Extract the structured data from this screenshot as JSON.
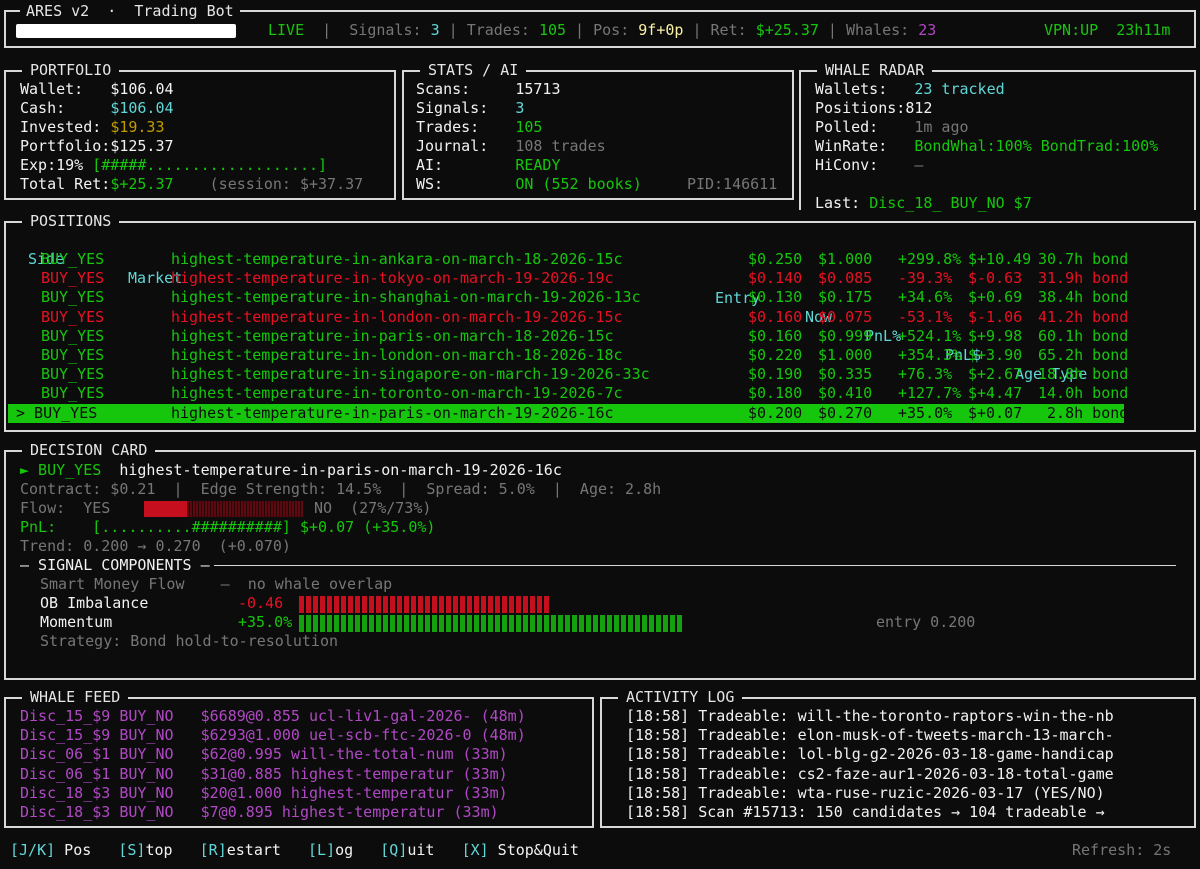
{
  "header": {
    "title": "ARES v2  ·  Trading Bot",
    "live": "LIVE",
    "signals_label": "Signals:",
    "signals": "3",
    "trades_label": "Trades:",
    "trades": "105",
    "pos_label": "Pos:",
    "pos": "9f+0p",
    "ret_label": "Ret:",
    "ret": "$+25.37",
    "whales_label": "Whales:",
    "whales": "23",
    "vpn": "VPN:UP",
    "uptime": "23h11m"
  },
  "portfolio": {
    "title": "PORTFOLIO",
    "wallet_label": "Wallet:",
    "wallet": "$106.04",
    "cash_label": "Cash:",
    "cash": "$106.04",
    "invested_label": "Invested:",
    "invested": "$19.33",
    "portfolio_label": "Portfolio:",
    "portfolio": "$125.37",
    "exp_label": "Exp:19%",
    "exp_bar": "[#####...................]",
    "exp_fraction": 0.19,
    "totalret_label": "Total Ret:",
    "totalret": "$+25.37",
    "session": "(session: $+37.37"
  },
  "stats": {
    "title": "STATS / AI",
    "scans_label": "Scans:",
    "scans": "15713",
    "signals_label": "Signals:",
    "signals": "3",
    "trades_label": "Trades:",
    "trades": "105",
    "journal_label": "Journal:",
    "journal": "108 trades",
    "ai_label": "AI:",
    "ai": "READY",
    "ws_label": "WS:",
    "ws": "ON (552 books)",
    "pid": "PID:146611"
  },
  "whale_radar": {
    "title": "WHALE RADAR",
    "wallets_label": "Wallets:",
    "wallets": "23 tracked",
    "positions_label": "Positions:",
    "positions": "812",
    "polled_label": "Polled:",
    "polled": "1m ago",
    "winrate_label": "WinRate:",
    "winrate": "BondWhal:100% BondTrad:100%",
    "hiconv_label": "HiConv:",
    "hiconv": "—",
    "last_label": "Last:",
    "last": "Disc_18_ BUY_NO $7"
  },
  "positions": {
    "title": "POSITIONS",
    "headers": {
      "side": "Side",
      "market": "Market",
      "entry": "Entry",
      "now": "Now",
      "pnlpct": "PnL%",
      "pnlusd": "PnL$",
      "age": "Age Type"
    },
    "rows": [
      {
        "side": "BUY_YES",
        "market": "highest-temperature-in-ankara-on-march-18-2026-15c",
        "entry": "$0.250",
        "now": "$1.000",
        "pnlpct": "+299.8%",
        "pnlusd": "$+10.49",
        "age": "30.7h bond",
        "tone": "green"
      },
      {
        "side": "BUY_YES",
        "market": "highest-temperature-in-tokyo-on-march-19-2026-19c",
        "entry": "$0.140",
        "now": "$0.085",
        "pnlpct": "-39.3%",
        "pnlusd": "$-0.63",
        "age": "31.9h bond",
        "tone": "red"
      },
      {
        "side": "BUY_YES",
        "market": "highest-temperature-in-shanghai-on-march-19-2026-13c",
        "entry": "$0.130",
        "now": "$0.175",
        "pnlpct": "+34.6%",
        "pnlusd": "$+0.69",
        "age": "38.4h bond",
        "tone": "green"
      },
      {
        "side": "BUY_YES",
        "market": "highest-temperature-in-london-on-march-19-2026-15c",
        "entry": "$0.160",
        "now": "$0.075",
        "pnlpct": "-53.1%",
        "pnlusd": "$-1.06",
        "age": "41.2h bond",
        "tone": "red"
      },
      {
        "side": "BUY_YES",
        "market": "highest-temperature-in-paris-on-march-18-2026-15c",
        "entry": "$0.160",
        "now": "$0.999",
        "pnlpct": "+524.1%",
        "pnlusd": "$+9.98",
        "age": "60.1h bond",
        "tone": "green"
      },
      {
        "side": "BUY_YES",
        "market": "highest-temperature-in-london-on-march-18-2026-18c",
        "entry": "$0.220",
        "now": "$1.000",
        "pnlpct": "+354.3%",
        "pnlusd": "$+3.90",
        "age": "65.2h bond",
        "tone": "green"
      },
      {
        "side": "BUY_YES",
        "market": "highest-temperature-in-singapore-on-march-19-2026-33c",
        "entry": "$0.190",
        "now": "$0.335",
        "pnlpct": "+76.3%",
        "pnlusd": "$+2.67",
        "age": "18.8h bond",
        "tone": "green"
      },
      {
        "side": "BUY_YES",
        "market": "highest-temperature-in-toronto-on-march-19-2026-7c",
        "entry": "$0.180",
        "now": "$0.410",
        "pnlpct": "+127.7%",
        "pnlusd": "$+4.47",
        "age": "14.0h bond",
        "tone": "green"
      },
      {
        "side": "> BUY_YES",
        "market": "highest-temperature-in-paris-on-march-19-2026-16c",
        "entry": "$0.200",
        "now": "$0.270",
        "pnlpct": "+35.0%",
        "pnlusd": "$+0.07",
        "age": " 2.8h bond",
        "tone": "selected"
      }
    ]
  },
  "decision": {
    "title": "DECISION CARD",
    "side": "► BUY_YES",
    "market": "highest-temperature-in-paris-on-march-19-2026-16c",
    "meta": "Contract: $0.21  |  Edge Strength: 14.5%  |  Spread: 5.0%  |  Age: 2.8h",
    "flow_label": "Flow:",
    "flow_yes": "YES",
    "flow_no": "NO",
    "flow_pct": "(27%/73%)",
    "flow_yes_fraction": 0.27,
    "pnl_label": "PnL:",
    "pnl_bar": "[..........##########]",
    "pnl_value": "$+0.07 (+35.0%)",
    "trend": "Trend: 0.200 → 0.270  (+0.070)",
    "components_title": "— SIGNAL COMPONENTS —",
    "smart_money_label": "Smart Money Flow",
    "smart_money_value": "—  no whale overlap",
    "ob_label": "OB Imbalance",
    "ob_value": "-0.46",
    "ob_ticks": 36,
    "momentum_label": "Momentum",
    "momentum_value": "+35.0%",
    "momentum_ticks": 55,
    "momentum_note": "entry 0.200",
    "strategy": "Strategy: Bond hold-to-resolution"
  },
  "whale_feed": {
    "title": "WHALE FEED",
    "rows": [
      "Disc_15_$9 BUY_NO   $6689@0.855 ucl-liv1-gal-2026- (48m)",
      "Disc_15_$9 BUY_NO   $6293@1.000 uel-scb-ftc-2026-0 (48m)",
      "Disc_06_$1 BUY_NO   $62@0.995 will-the-total-num (33m)",
      "Disc_06_$1 BUY_NO   $31@0.885 highest-temperatur (33m)",
      "Disc_18_$3 BUY_NO   $20@1.000 highest-temperatur (33m)",
      "Disc_18_$3 BUY_NO   $7@0.895 highest-temperatur (33m)"
    ]
  },
  "activity": {
    "title": "ACTIVITY LOG",
    "rows": [
      "[18:58] Tradeable: will-the-toronto-raptors-win-the-nb",
      "[18:58] Tradeable: elon-musk-of-tweets-march-13-march-",
      "[18:58] Tradeable: lol-blg-g2-2026-03-18-game-handicap",
      "[18:58] Tradeable: cs2-faze-aur1-2026-03-18-total-game",
      "[18:58] Tradeable: wta-ruse-ruzic-2026-03-17 (YES/NO)",
      "[18:58] Scan #15713: 150 candidates → 104 tradeable →"
    ]
  },
  "footer": {
    "keys": [
      {
        "key": "[J/K]",
        "label": "Pos"
      },
      {
        "key": "[S]",
        "label": "top"
      },
      {
        "key": "[R]",
        "label": "estart"
      },
      {
        "key": "[L]",
        "label": "og"
      },
      {
        "key": "[Q]",
        "label": "uit"
      },
      {
        "key": "[X]",
        "label": "Stop&Quit"
      }
    ],
    "refresh": "Refresh: 2s"
  },
  "colors": {
    "green": "#16c60c",
    "red": "#e81123",
    "cyan": "#61d6d6",
    "yellow": "#c19c00",
    "magenta": "#b148c6",
    "selected_bg": "#16c60c"
  }
}
